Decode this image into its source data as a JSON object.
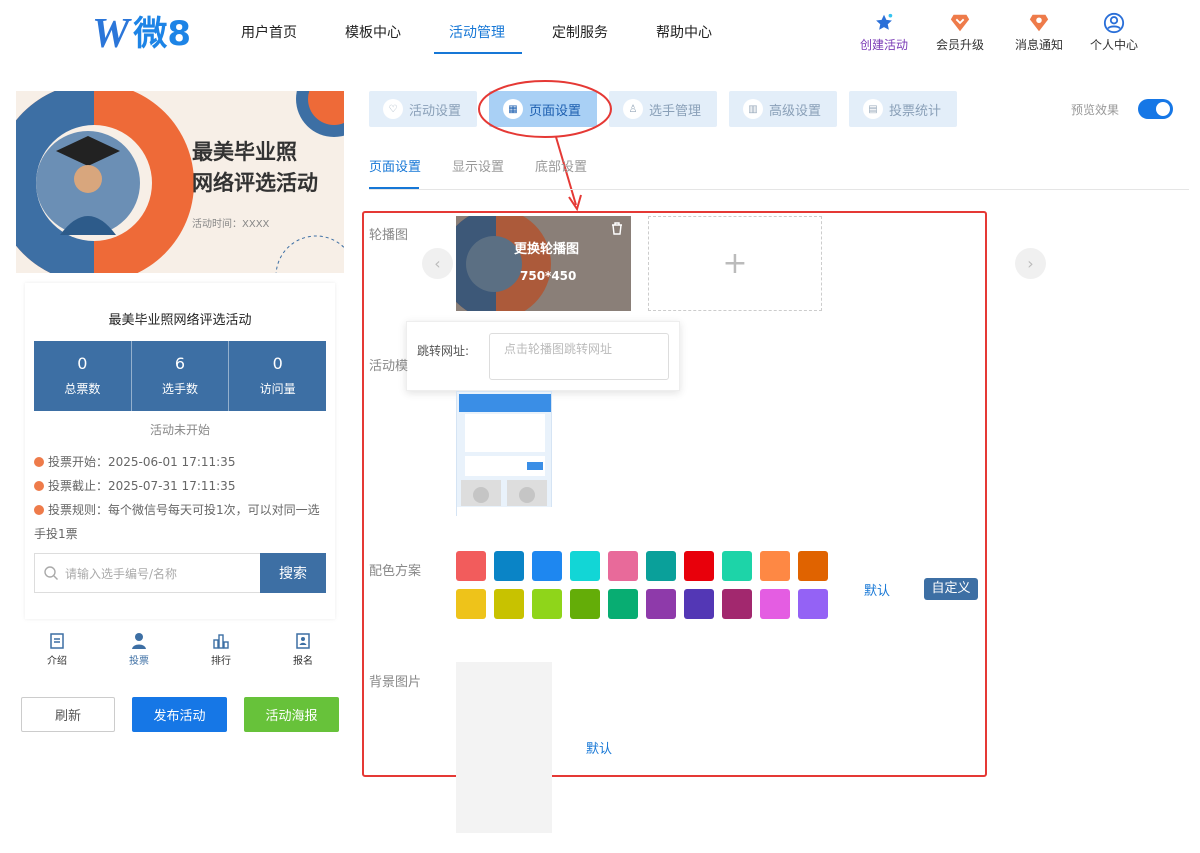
{
  "brand": {
    "logo_letter": "W",
    "logo_text": "微8"
  },
  "nav": {
    "items": [
      "用户首页",
      "模板中心",
      "活动管理",
      "定制服务",
      "帮助中心"
    ],
    "active": 2
  },
  "right_nav": {
    "create": "创建活动",
    "upgrade": "会员升级",
    "notify": "消息通知",
    "profile": "个人中心"
  },
  "preview": {
    "banner_title_1": "最美毕业照",
    "banner_title_2": "网络评选活动",
    "banner_time": "活动时间：XXXX",
    "title": "最美毕业照网络评选活动",
    "stats": [
      {
        "value": "0",
        "label": "总票数"
      },
      {
        "value": "6",
        "label": "选手数"
      },
      {
        "value": "0",
        "label": "访问量"
      }
    ],
    "status": "活动未开始",
    "vote_start": "投票开始：2025-06-01 17:11:35",
    "vote_end": "投票截止：2025-07-31 17:11:35",
    "vote_rule": "投票规则：每个微信号每天可投1次，可以对同一选手投1票",
    "search_placeholder": "请输入选手编号/名称",
    "search_btn": "搜索",
    "tabs": [
      "介绍",
      "投票",
      "排行",
      "报名"
    ]
  },
  "actions": {
    "refresh": "刷新",
    "publish": "发布活动",
    "poster": "活动海报"
  },
  "settings": {
    "tabs": [
      "活动设置",
      "页面设置",
      "选手管理",
      "高级设置",
      "投票统计"
    ],
    "active_tab": 1,
    "preview_label": "预览效果",
    "preview_on": true,
    "subtabs": [
      "页面设置",
      "显示设置",
      "底部设置"
    ],
    "carousel_label": "轮播图",
    "carousel_change": "更换轮播图",
    "carousel_size": "750*450",
    "jump_label": "跳转网址:",
    "jump_placeholder": "点击轮播图跳转网址",
    "template_label": "活动模",
    "color_label": "配色方案",
    "color_default": "默认",
    "color_custom": "自定义",
    "bg_label": "背景图片",
    "bg_default": "默认",
    "colors": [
      "#f25c5c",
      "#0a84c6",
      "#1e87f0",
      "#12d6d6",
      "#e86a9a",
      "#0aa09a",
      "#e8000b",
      "#1dd4a8",
      "#fe8844",
      "#e06300",
      "#eec31a",
      "#c8c200",
      "#8fd51a",
      "#64ad08",
      "#08ad72",
      "#8e3aaa",
      "#5337b5",
      "#a2286e",
      "#e45de2",
      "#9462f5"
    ]
  }
}
